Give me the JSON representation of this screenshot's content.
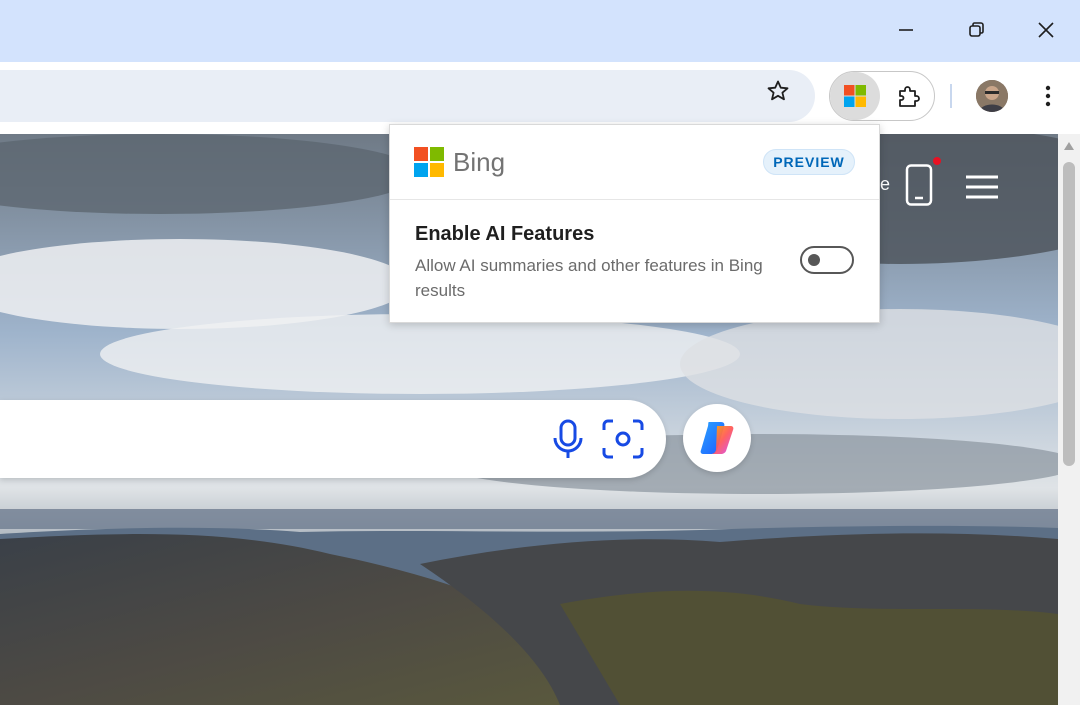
{
  "window": {
    "minimize_icon": "minimize-icon",
    "restore_icon": "restore-icon",
    "close_icon": "close-icon"
  },
  "toolbar": {
    "bookmark_icon": "star-icon",
    "extensions": [
      "bing-extension-icon",
      "puzzle-icon"
    ],
    "menu_icon": "kebab-icon"
  },
  "page_header": {
    "partial_text": "e",
    "icons": [
      "phone-icon",
      "hamburger-menu-icon"
    ]
  },
  "search": {
    "icons": [
      "microphone-icon",
      "visual-search-icon",
      "copilot-icon"
    ]
  },
  "popup": {
    "brand": "Bing",
    "badge": "PREVIEW",
    "feature_title": "Enable AI Features",
    "feature_description": "Allow AI summaries and other features in Bing results",
    "toggle_on": false
  },
  "colors": {
    "titlebar": "#d3e3fd",
    "accent": "#0067b8",
    "toggle_off": "#575757"
  }
}
